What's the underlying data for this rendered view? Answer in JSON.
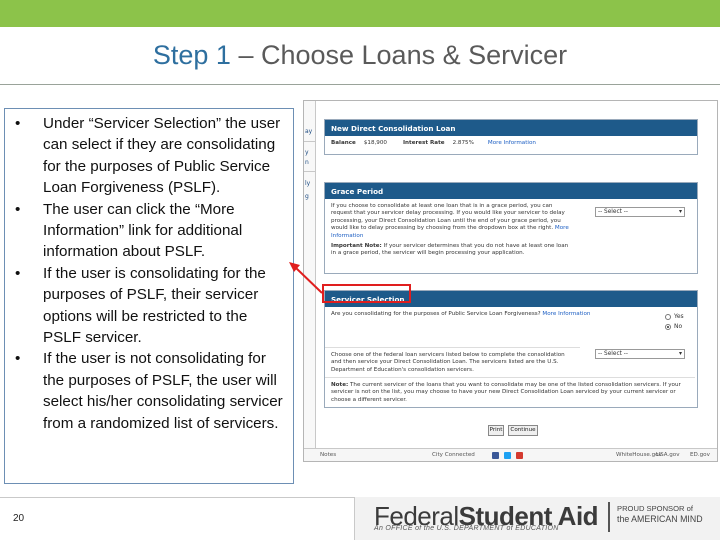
{
  "slide": {
    "title_step": "Step 1",
    "title_rest": " – Choose Loans & Servicer",
    "page_number": "20",
    "accent_color": "#8cc34a",
    "title_color": "#2e6f9f"
  },
  "bullets": [
    "Under “Servicer Selection” the user can select if they are consolidating for the purposes of Public Service Loan Forgiveness (PSLF).",
    "The user can click the “More Information” link for additional information about PSLF.",
    "If the user is consolidating for the purposes of PSLF, their servicer options will be restricted to the PSLF servicer.",
    "If the user is not consolidating for the purposes of PSLF, the user will select his/her consolidating servicer from a randomized list of servicers."
  ],
  "bullet_glyph": "•",
  "screenshot": {
    "sidebar_frags": [
      "ay",
      "y",
      "n",
      "ly",
      "g"
    ],
    "new_loan": {
      "header": "New Direct Consolidation Loan",
      "balance_label": "Balance",
      "balance_value": "$18,900",
      "rate_label": "Interest Rate",
      "rate_value": "2.875%",
      "more_info": "More Information"
    },
    "grace": {
      "header": "Grace Period",
      "text": "If you choose to consolidate at least one loan that is in a grace period, you can request that your servicer delay processing. If you would like your servicer to delay processing, your Direct Consolidation Loan until the end of your grace period, you would like to delay processing by choosing from the dropdown box at the right.",
      "more_info": "More Information",
      "note_label": "Important Note:",
      "note_text": "If your servicer determines that you do not have at least one loan in a grace period, the servicer will begin processing your application.",
      "select_value": "-- Select --"
    },
    "servicer": {
      "header": "Servicer Selection",
      "question": "Are you consolidating for the purposes of Public Service Loan Forgiveness?",
      "more_info": "More Information",
      "yes_label": "Yes",
      "no_label": "No",
      "choose_text": "Choose one of the federal loan servicers listed below to complete the consolidation and then service your Direct Consolidation Loan. The servicers listed are the U.S. Department of Education's consolidation servicers.",
      "select_value": "-- Select --",
      "note_label": "Note:",
      "note_text": "The current servicer of the loans that you want to consolidate may be one of the listed consolidation servicers. If your servicer is not on the list, you may choose to have your new Direct Consolidation Loan serviced by your current servicer or choose a different servicer."
    },
    "buttons": {
      "print": "Print",
      "continue": "Continue"
    },
    "footer": {
      "notes": "Notes",
      "city": "City Connected",
      "ussites": "WhiteHouse.gov",
      "usa": "USA.gov",
      "edgov": "ED.gov"
    }
  },
  "branding": {
    "fsa_light": "Federal",
    "fsa_bold": "Student Aid",
    "fsa_sub": "An OFFICE of the U.S. DEPARTMENT of EDUCATION",
    "proud_line1": "PROUD SPONSOR of",
    "proud_line2": "the AMERICAN MIND"
  }
}
